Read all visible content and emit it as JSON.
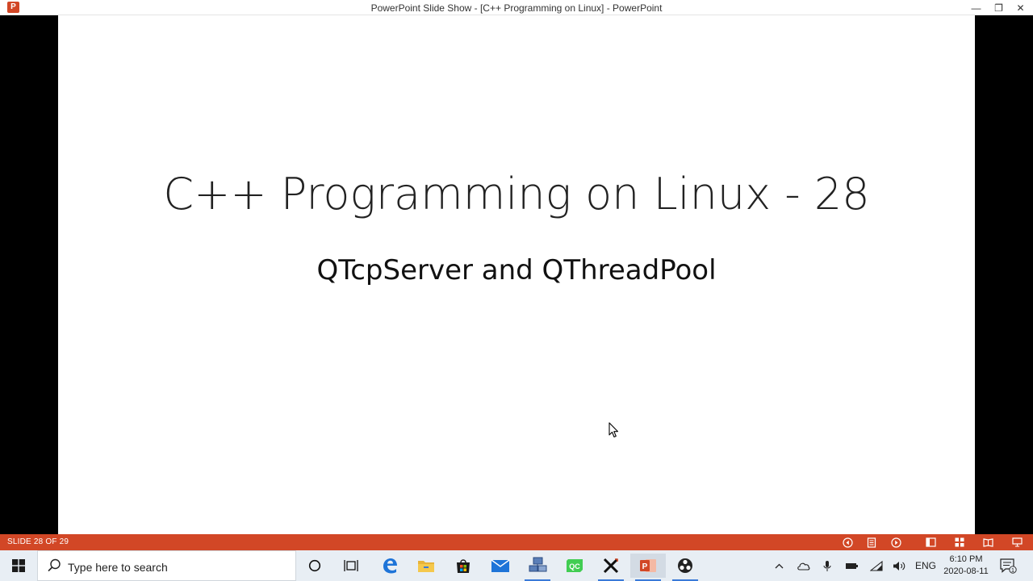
{
  "window": {
    "app_icon": "powerpoint-icon",
    "app_icon_letter": "P",
    "title": "PowerPoint Slide Show - [C++ Programming on Linux] - PowerPoint",
    "minimize": "—",
    "restore": "❐",
    "close": "✕"
  },
  "slide": {
    "title": "C++ Programming on Linux - 28",
    "subtitle": "QTcpServer and QThreadPool"
  },
  "statusbar": {
    "slide_indicator": "SLIDE 28 OF 29",
    "color": "#d24726",
    "buttons": [
      "previous-icon",
      "slide-menu-icon",
      "next-icon",
      "normal-view-icon",
      "slide-sorter-icon",
      "reading-view-icon",
      "slide-show-icon"
    ]
  },
  "taskbar": {
    "search_placeholder": "Type here to search",
    "apps": [
      "cortana-icon",
      "task-view-icon",
      "edge-icon",
      "file-explorer-icon",
      "store-icon",
      "mail-icon",
      "network-app-icon",
      "qt-creator-icon",
      "x-app-icon",
      "powerpoint-icon",
      "obs-icon"
    ],
    "qt_label": "QC",
    "language": "ENG",
    "time": "6:10 PM",
    "date": "2020-08-11",
    "notification_count": "1"
  }
}
